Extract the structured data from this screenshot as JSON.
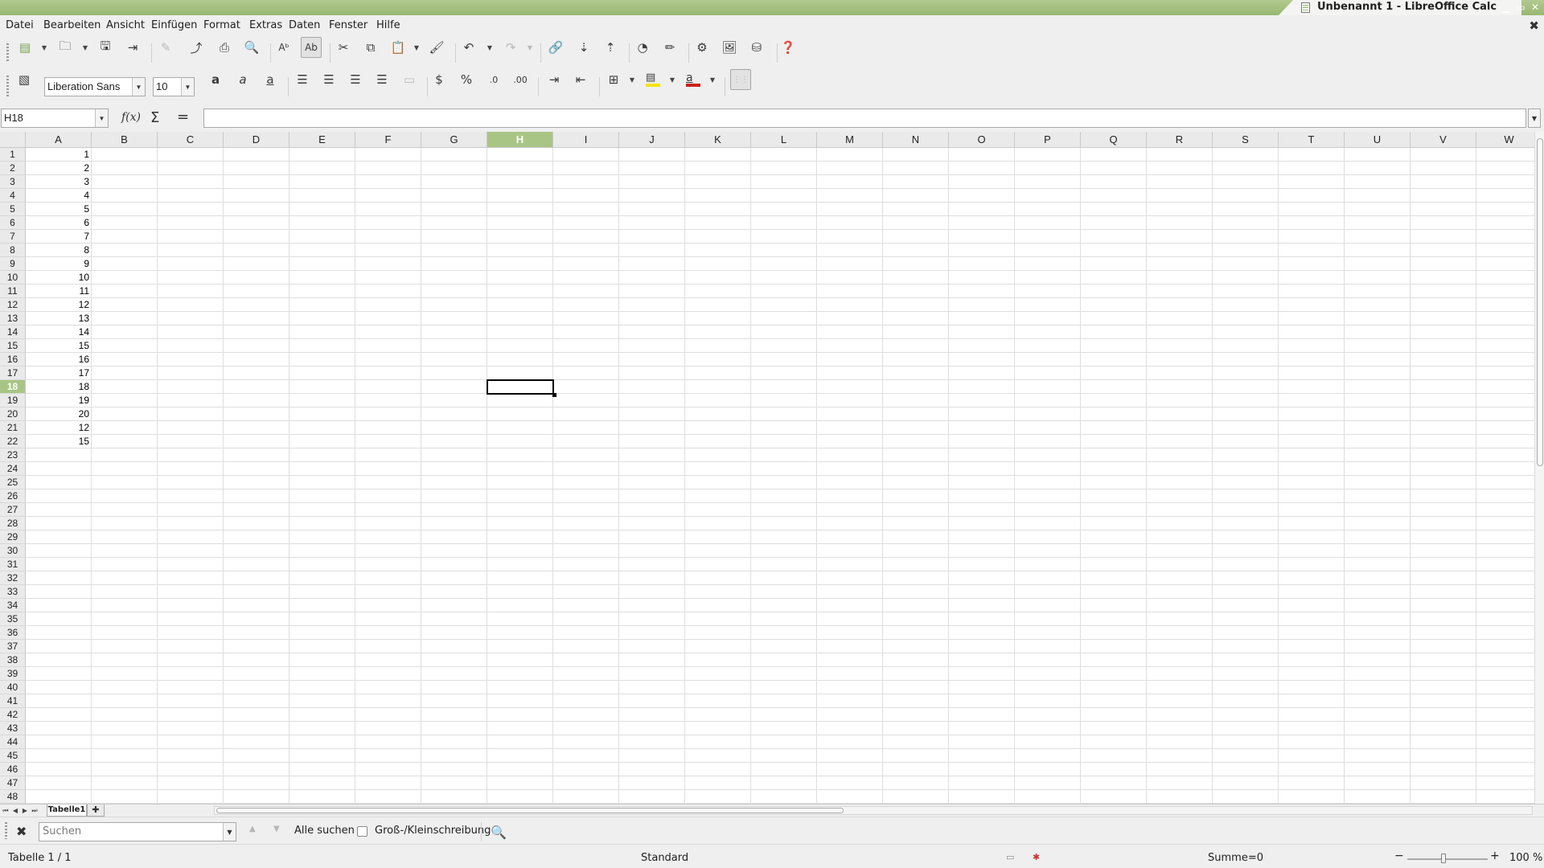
{
  "window": {
    "title": "Unbenannt 1 - LibreOffice Calc",
    "controls": [
      "minimize",
      "maximize",
      "close"
    ]
  },
  "menu": [
    {
      "label": "Datei"
    },
    {
      "label": "Bearbeiten"
    },
    {
      "label": "Ansicht"
    },
    {
      "label": "Einfügen"
    },
    {
      "label": "Format"
    },
    {
      "label": "Extras"
    },
    {
      "label": "Daten"
    },
    {
      "label": "Fenster"
    },
    {
      "label": "Hilfe"
    }
  ],
  "formatting": {
    "font_name": "Liberation Sans",
    "font_size": "10"
  },
  "formula_bar": {
    "name_box": "H18",
    "function_wizard": "f(x)",
    "sum_symbol": "Σ",
    "equals_symbol": "=",
    "content": ""
  },
  "grid": {
    "columns": [
      "A",
      "B",
      "C",
      "D",
      "E",
      "F",
      "G",
      "H",
      "I",
      "J",
      "K",
      "L",
      "M",
      "N",
      "O",
      "P",
      "Q",
      "R",
      "S",
      "T",
      "U",
      "V",
      "W"
    ],
    "selected_column": "H",
    "selected_row": 18,
    "rows": [
      1,
      2,
      3,
      4,
      5,
      6,
      7,
      8,
      9,
      10,
      11,
      12,
      13,
      14,
      15,
      16,
      17,
      18,
      19,
      20,
      21,
      22,
      23,
      24,
      25,
      26,
      27,
      28,
      29,
      30,
      31,
      32,
      33,
      34,
      35,
      36,
      37,
      38,
      39,
      40,
      41,
      42,
      43,
      44,
      45,
      46,
      47,
      48
    ],
    "column_a_values": [
      "1",
      "2",
      "3",
      "4",
      "5",
      "6",
      "7",
      "8",
      "9",
      "10",
      "11",
      "12",
      "13",
      "14",
      "15",
      "16",
      "17",
      "18",
      "19",
      "20",
      "12",
      "15"
    ]
  },
  "sheets": {
    "tabs": [
      "Tabelle1"
    ],
    "active": "Tabelle1"
  },
  "find_bar": {
    "placeholder": "Suchen",
    "find_all": "Alle suchen",
    "match_case": "Groß-/Kleinschreibung",
    "match_case_checked": false
  },
  "status": {
    "sheet": "Tabelle 1 / 1",
    "page_style": "Standard",
    "sum": "Summe=0",
    "zoom": "100 %"
  },
  "colors": {
    "accent_green": "#a9c585",
    "titlebar_green": "#98b873"
  }
}
